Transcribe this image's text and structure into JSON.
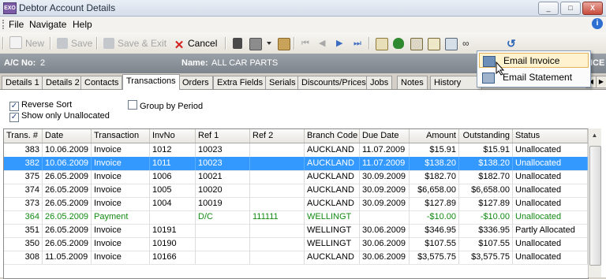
{
  "window": {
    "title": "Debtor Account Details",
    "app_icon": "EXO",
    "min": "_",
    "max": "□",
    "close": "X"
  },
  "menu": {
    "file": "File",
    "navigate": "Navigate",
    "help": "Help"
  },
  "toolbar": {
    "new": "New",
    "save": "Save",
    "save_exit": "Save & Exit",
    "cancel": "Cancel"
  },
  "account": {
    "ac_label": "A/C No:",
    "ac_value": "2",
    "name_label": "Name:",
    "name_value": "ALL CAR PARTS",
    "clipped_right": "ICE"
  },
  "tabs": [
    "Details 1",
    "Details 2",
    "Contacts",
    "Transactions",
    "Orders",
    "Extra Fields",
    "Serials",
    "Discounts/Prices",
    "Jobs",
    "Notes",
    "History Note"
  ],
  "active_tab": "Transactions",
  "options": {
    "reverse_sort": "Reverse Sort",
    "show_unallocated": "Show only Unallocated",
    "group_by_period": "Group by Period",
    "check_mark": "✓"
  },
  "table": {
    "columns": [
      "Trans. #",
      "Date",
      "Transaction",
      "InvNo",
      "Ref 1",
      "Ref 2",
      "Branch Code",
      "Due Date",
      "Amount",
      "Outstanding",
      "Status"
    ],
    "rows": [
      [
        "383",
        "10.06.2009",
        "Invoice",
        "1012",
        "10023",
        "",
        "AUCKLAND",
        "11.07.2009",
        "$15.91",
        "$15.91",
        "Unallocated"
      ],
      [
        "382",
        "10.06.2009",
        "Invoice",
        "1011",
        "10023",
        "",
        "AUCKLAND",
        "11.07.2009",
        "$138.20",
        "$138.20",
        "Unallocated"
      ],
      [
        "375",
        "26.05.2009",
        "Invoice",
        "1006",
        "10021",
        "",
        "AUCKLAND",
        "30.09.2009",
        "$182.70",
        "$182.70",
        "Unallocated"
      ],
      [
        "374",
        "26.05.2009",
        "Invoice",
        "1005",
        "10020",
        "",
        "AUCKLAND",
        "30.09.2009",
        "$6,658.00",
        "$6,658.00",
        "Unallocated"
      ],
      [
        "373",
        "26.05.2009",
        "Invoice",
        "1004",
        "10019",
        "",
        "AUCKLAND",
        "30.09.2009",
        "$127.89",
        "$127.89",
        "Unallocated"
      ],
      [
        "364",
        "26.05.2009",
        "Payment",
        "",
        "D/C",
        "111111",
        "WELLINGT",
        "",
        "-$10.00",
        "-$10.00",
        "Unallocated"
      ],
      [
        "351",
        "26.05.2009",
        "Invoice",
        "10191",
        "",
        "",
        "WELLINGT",
        "30.06.2009",
        "$346.95",
        "$336.95",
        "Partly Allocated"
      ],
      [
        "350",
        "26.05.2009",
        "Invoice",
        "10190",
        "",
        "",
        "WELLINGT",
        "30.06.2009",
        "$107.55",
        "$107.55",
        "Unallocated"
      ],
      [
        "308",
        "11.05.2009",
        "Invoice",
        "10166",
        "",
        "",
        "AUCKLAND",
        "30.06.2009",
        "$3,575.75",
        "$3,575.75",
        "Unallocated"
      ]
    ],
    "selected_row": 1,
    "payment_row": 5
  },
  "dropdown": {
    "items": [
      "Email Invoice",
      "Email Statement"
    ]
  },
  "colors": {
    "selection": "#3399ff",
    "payment_text": "#138a13",
    "cancel_x": "#d22020"
  }
}
